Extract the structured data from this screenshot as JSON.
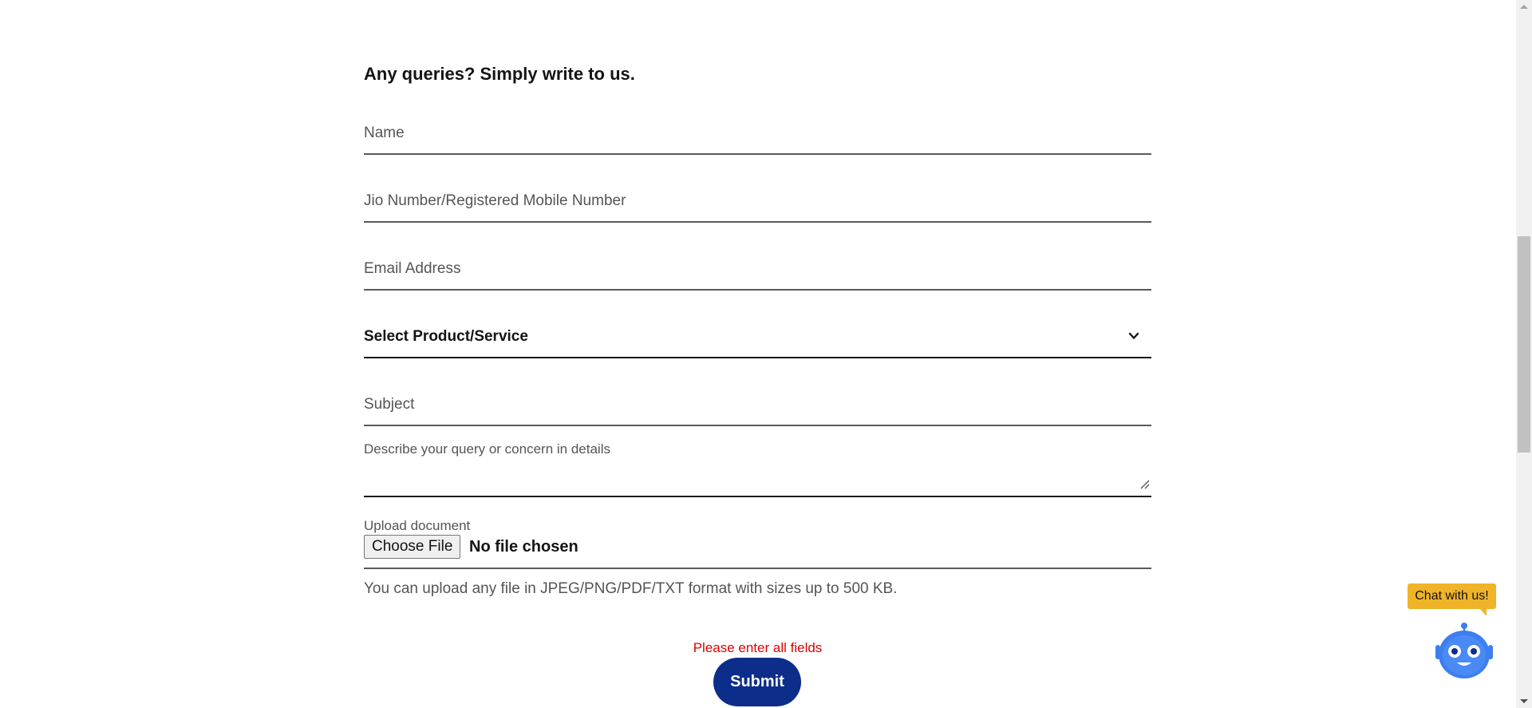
{
  "form": {
    "heading": "Any queries? Simply write to us.",
    "name_placeholder": "Name",
    "mobile_placeholder": "Jio Number/Registered Mobile Number",
    "email_placeholder": "Email Address",
    "product_select_value": "Select Product/Service",
    "subject_placeholder": "Subject",
    "description_label": "Describe your query or concern in details",
    "upload_label": "Upload document",
    "choose_file_label": "Choose File",
    "file_status": "No file chosen",
    "upload_hint": "You can upload any file in JPEG/PNG/PDF/TXT format with sizes up to 500 KB.",
    "error_message": "Please enter all fields",
    "submit_label": "Submit"
  },
  "chat": {
    "bubble_text": "Chat with us!",
    "bot_icon": "robot-icon"
  },
  "colors": {
    "submit_bg": "#0c2d8a",
    "error_text": "#e00000",
    "chat_bubble_bg": "#f0b429",
    "bot_blue": "#3d7ef0"
  },
  "icons": {
    "select_chevron": "chevron-down-icon",
    "textarea_resize": "resize-handle-icon"
  }
}
